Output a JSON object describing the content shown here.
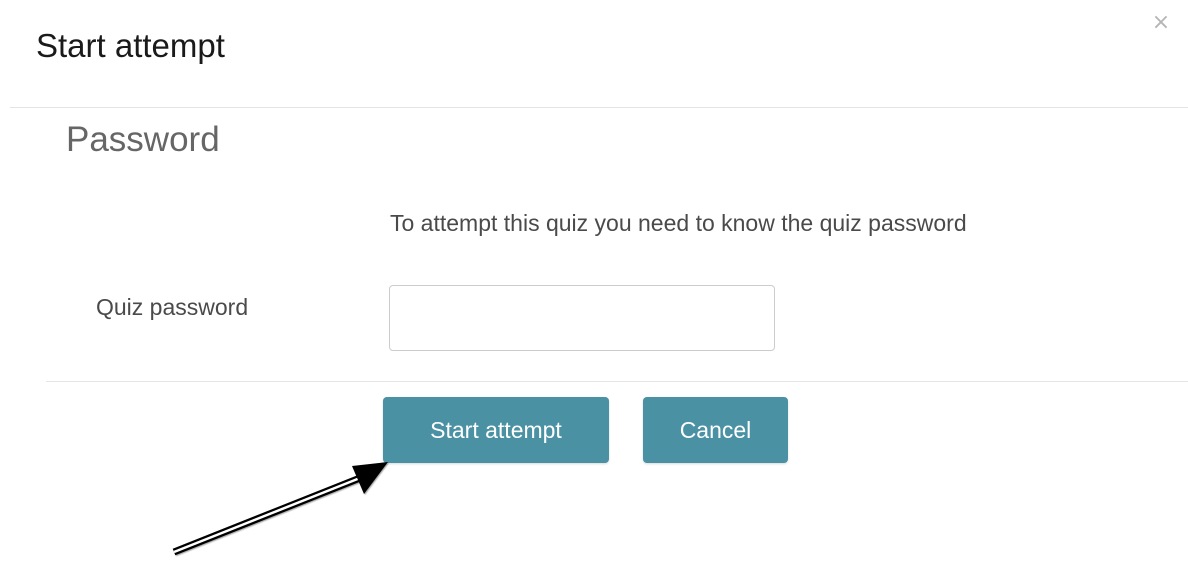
{
  "dialog": {
    "title": "Start attempt",
    "close_glyph": "×",
    "close_icon": "close-icon"
  },
  "section": {
    "legend": "Password",
    "info_text": "To attempt this quiz you need to know the quiz password",
    "field_label": "Quiz password",
    "password_value": ""
  },
  "buttons": {
    "start_label": "Start attempt",
    "cancel_label": "Cancel"
  },
  "annotation": {
    "type": "arrow",
    "points_to": "start-attempt-button"
  },
  "colors": {
    "button_bg": "#4a91a4",
    "button_text": "#ffffff",
    "title_text": "#1a1a1a",
    "legend_text": "#666666",
    "divider": "#e5e5e5"
  }
}
